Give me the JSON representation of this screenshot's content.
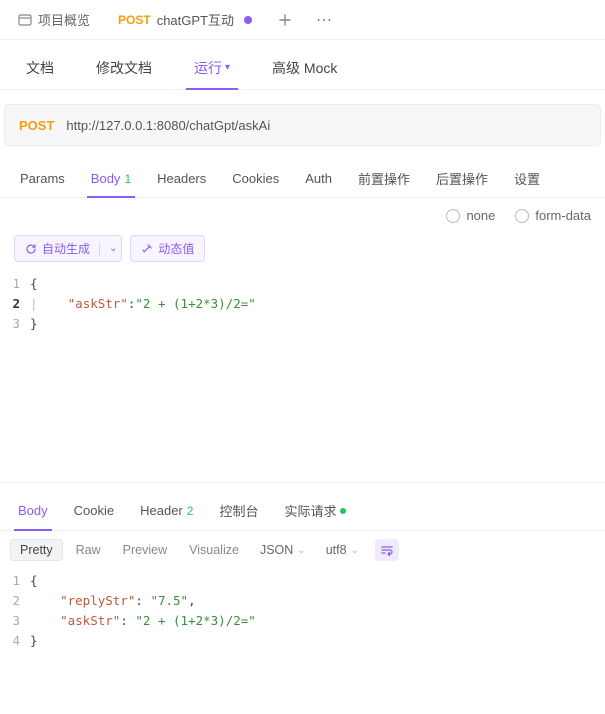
{
  "topTabs": {
    "overview": {
      "label": "项目概览"
    },
    "api": {
      "method": "POST",
      "name": "chatGPT互动"
    }
  },
  "subNav": {
    "doc": "文档",
    "editDoc": "修改文档",
    "run": "运行",
    "mock": "高级 Mock"
  },
  "request": {
    "method": "POST",
    "url": "http://127.0.0.1:8080/chatGpt/askAi"
  },
  "reqTabs": {
    "params": "Params",
    "body": "Body",
    "bodyCount": "1",
    "headers": "Headers",
    "cookies": "Cookies",
    "auth": "Auth",
    "pre": "前置操作",
    "post": "后置操作",
    "settings": "设置"
  },
  "bodyTypes": {
    "none": "none",
    "formData": "form-data"
  },
  "editorToolbar": {
    "autoGen": "自动生成",
    "dynamic": "动态值"
  },
  "requestBody": {
    "line1": "{",
    "line2_key": "\"askStr\"",
    "line2_val": "\"2 + (1+2*3)/2=\"",
    "line3": "}"
  },
  "respTabs": {
    "body": "Body",
    "cookie": "Cookie",
    "header": "Header",
    "headerCount": "2",
    "console": "控制台",
    "actual": "实际请求"
  },
  "respControls": {
    "pretty": "Pretty",
    "raw": "Raw",
    "preview": "Preview",
    "visualize": "Visualize",
    "format": "JSON",
    "encoding": "utf8"
  },
  "responseBody": {
    "line1": "{",
    "line2_key": "\"replyStr\"",
    "line2_val": "\"7.5\"",
    "line3_key": "\"askStr\"",
    "line3_val": "\"2 + (1+2*3)/2=\"",
    "line4": "}"
  }
}
